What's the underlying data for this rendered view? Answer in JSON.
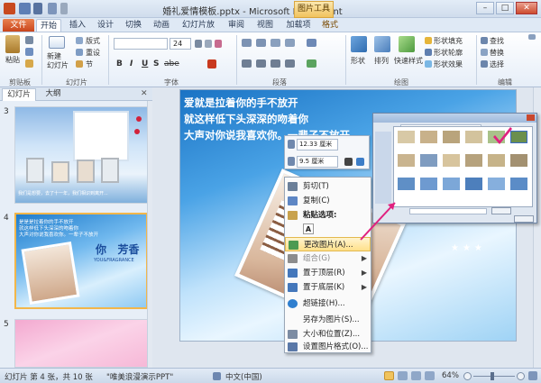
{
  "window": {
    "title": "婚礼爱情模板.pptx - Microsoft PowerPoint",
    "context_tool": "图片工具",
    "buttons": [
      "–",
      "□",
      "✕"
    ]
  },
  "tabs": {
    "file": "文件",
    "items": [
      "开始",
      "插入",
      "设计",
      "切换",
      "动画",
      "幻灯片放映",
      "审阅",
      "视图",
      "加载项",
      "格式"
    ],
    "active": "开始"
  },
  "ribbon": {
    "clipboard": {
      "label": "剪贴板",
      "paste": "粘贴"
    },
    "slides": {
      "label": "幻灯片",
      "new_slide": "新建\n幻灯片",
      "layout": "版式",
      "reset": "重设",
      "section": "节"
    },
    "font": {
      "label": "字体",
      "size": "24",
      "bold": "B",
      "italic": "I",
      "underline": "U",
      "strike": "S",
      "spacing": "abe"
    },
    "paragraph": {
      "label": "段落"
    },
    "drawing": {
      "label": "绘图",
      "shapes": "形状",
      "arrange": "排列",
      "quick_styles": "快速样式",
      "fill": "形状填充",
      "outline": "形状轮廓",
      "effects": "形状效果"
    },
    "editing": {
      "label": "编辑",
      "find": "查找",
      "replace": "替换",
      "select": "选择"
    }
  },
  "pane": {
    "tabs": [
      "幻灯片",
      "大纲"
    ],
    "slides": [
      {
        "number": "3",
        "caption": "我们是想要，去了十一年，我们相识到离开..."
      },
      {
        "number": "4",
        "lines": [
          "是是是拉着你的手不放开",
          "就这样低下头深深的吻着你",
          "大声对你说我喜欢你。一辈子不放开"
        ],
        "title": "你   芳香",
        "subtitle": "YOU&FRAGRANCE"
      },
      {
        "number": "5"
      }
    ]
  },
  "slide": {
    "poem": [
      "爱就是拉着你的手不放开",
      "就这样低下头深深的吻着你",
      "大声对你说我喜欢你。一辈子不放开"
    ]
  },
  "mini_toolbar": {
    "width": "12.33 厘米",
    "height": "9.5 厘米"
  },
  "context_menu": {
    "items": [
      {
        "label": "剪切(T)",
        "color": "#6b7f99"
      },
      {
        "label": "复制(C)",
        "color": "#5d86c4"
      },
      {
        "label": "粘贴选项:",
        "color": "#c8a24d"
      },
      {
        "label": "A",
        "color": "#ffffff"
      },
      {
        "label": "更改图片(A)...",
        "color": "#4c9a52",
        "highlight": true
      },
      {
        "label": "组合(G)",
        "color": "#8c8c8c",
        "disabled": true,
        "submenu": "▶"
      },
      {
        "label": "置于顶层(R)",
        "color": "#4477bb",
        "submenu": "▶"
      },
      {
        "label": "置于底层(K)",
        "color": "#4477bb",
        "submenu": "▶"
      },
      {
        "label": "超链接(H)...",
        "color": "#2f7fcf"
      },
      {
        "label": "另存为图片(S)...",
        "color": "#ffffff"
      },
      {
        "label": "大小和位置(Z)...",
        "color": "#7c8ca3"
      },
      {
        "label": "设置图片格式(O)...",
        "color": "#5a78a8"
      }
    ]
  },
  "status_bar": {
    "slide_info": "幻灯片 第 4 张，共 10 张",
    "theme": "\"唯美浪漫演示PPT\"",
    "language": "中文(中国)",
    "zoom": "64%"
  },
  "colors": {
    "highlight_arrow": "#e0217f",
    "file_tab": "#d4562b",
    "selection": "#f2b64a"
  }
}
